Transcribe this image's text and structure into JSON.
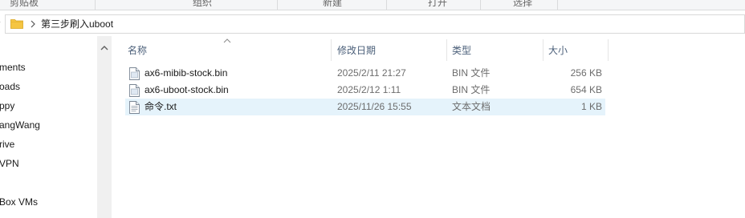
{
  "ribbon": {
    "groups": [
      "剪贴板",
      "组织",
      "新建",
      "打开",
      "选择"
    ]
  },
  "address": {
    "folder_icon": "folder-icon",
    "separator_icon": "chevron-right-icon",
    "current_folder": "第三步刷入uboot"
  },
  "nav": {
    "items": [
      "ments",
      "oads",
      "ppy",
      "angWang",
      "rive",
      "VPN",
      "Box VMs"
    ]
  },
  "columns": {
    "name": "名称",
    "date": "修改日期",
    "type": "类型",
    "size": "大小",
    "sort_indicator": "sort-ascending-icon"
  },
  "files": [
    {
      "name": "ax6-mibib-stock.bin",
      "date": "2025/2/11 21:27",
      "type": "BIN 文件",
      "size": "256 KB",
      "icon": "bin-file-icon",
      "selected": false
    },
    {
      "name": "ax6-uboot-stock.bin",
      "date": "2025/2/12 1:11",
      "type": "BIN 文件",
      "size": "654 KB",
      "icon": "bin-file-icon",
      "selected": false
    },
    {
      "name": "命令.txt",
      "date": "2025/11/26 15:55",
      "type": "文本文档",
      "size": "1 KB",
      "icon": "text-file-icon",
      "selected": true
    }
  ],
  "colors": {
    "selection": "#e5f3fb",
    "folder": "#f5c542",
    "header_text": "#4c607a"
  }
}
